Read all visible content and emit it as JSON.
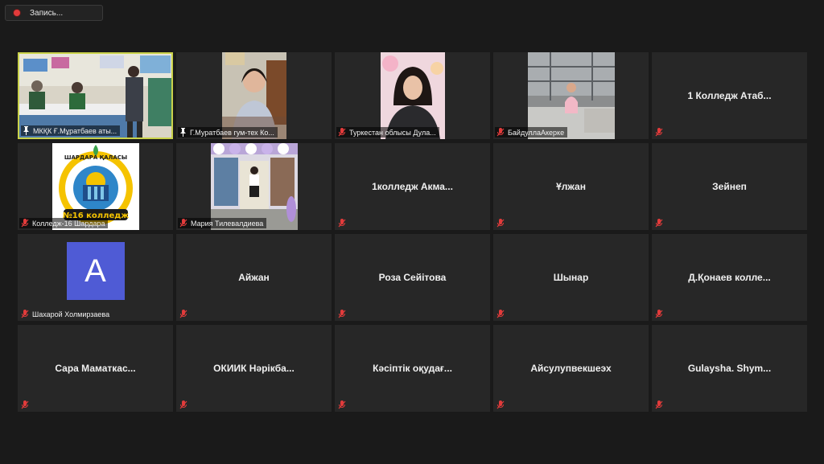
{
  "recording": {
    "label": "Запись..."
  },
  "colors": {
    "active_speaker_border": "#c9d24a",
    "avatar_bg": "#4f5bd5",
    "muted_mic": "#e23b3b"
  },
  "participants": [
    {
      "label": "МКҚК Ғ.Мұратбаев аты...",
      "video": true,
      "pinned": true,
      "active": true
    },
    {
      "label": "Г.Муратбаев гум-тех Ко...",
      "video": true,
      "pinned": true
    },
    {
      "label": "Туркестан облысы Дула...",
      "video": true
    },
    {
      "label": "БайдуллаАкерке",
      "video": true
    },
    {
      "name": "1 Колледж Атаб..."
    },
    {
      "label": "Колледж-16 Шардара",
      "video": true,
      "logo_text": "ШАРДАРА ҚАЛАСЫ",
      "logo_subtext": "№16 колледж"
    },
    {
      "label": "Мария Тилевалдиева",
      "video": true
    },
    {
      "name": "1колледж Акма..."
    },
    {
      "name": "Ұлжан"
    },
    {
      "name": "Зейнеп"
    },
    {
      "label": "Шахарой Холмирзаева",
      "avatar": "A"
    },
    {
      "name": "Айжан"
    },
    {
      "name": "Роза Сейітова"
    },
    {
      "name": "Шынар"
    },
    {
      "name": "Д.Қонаев колле..."
    },
    {
      "name": "Сара Маматкас..."
    },
    {
      "name": "ОКИИК Нәрікба..."
    },
    {
      "name": "Кәсіптік оқудағ..."
    },
    {
      "name": "Айсулупвекшеэх"
    },
    {
      "name": "Gulaysha. Shym..."
    }
  ]
}
